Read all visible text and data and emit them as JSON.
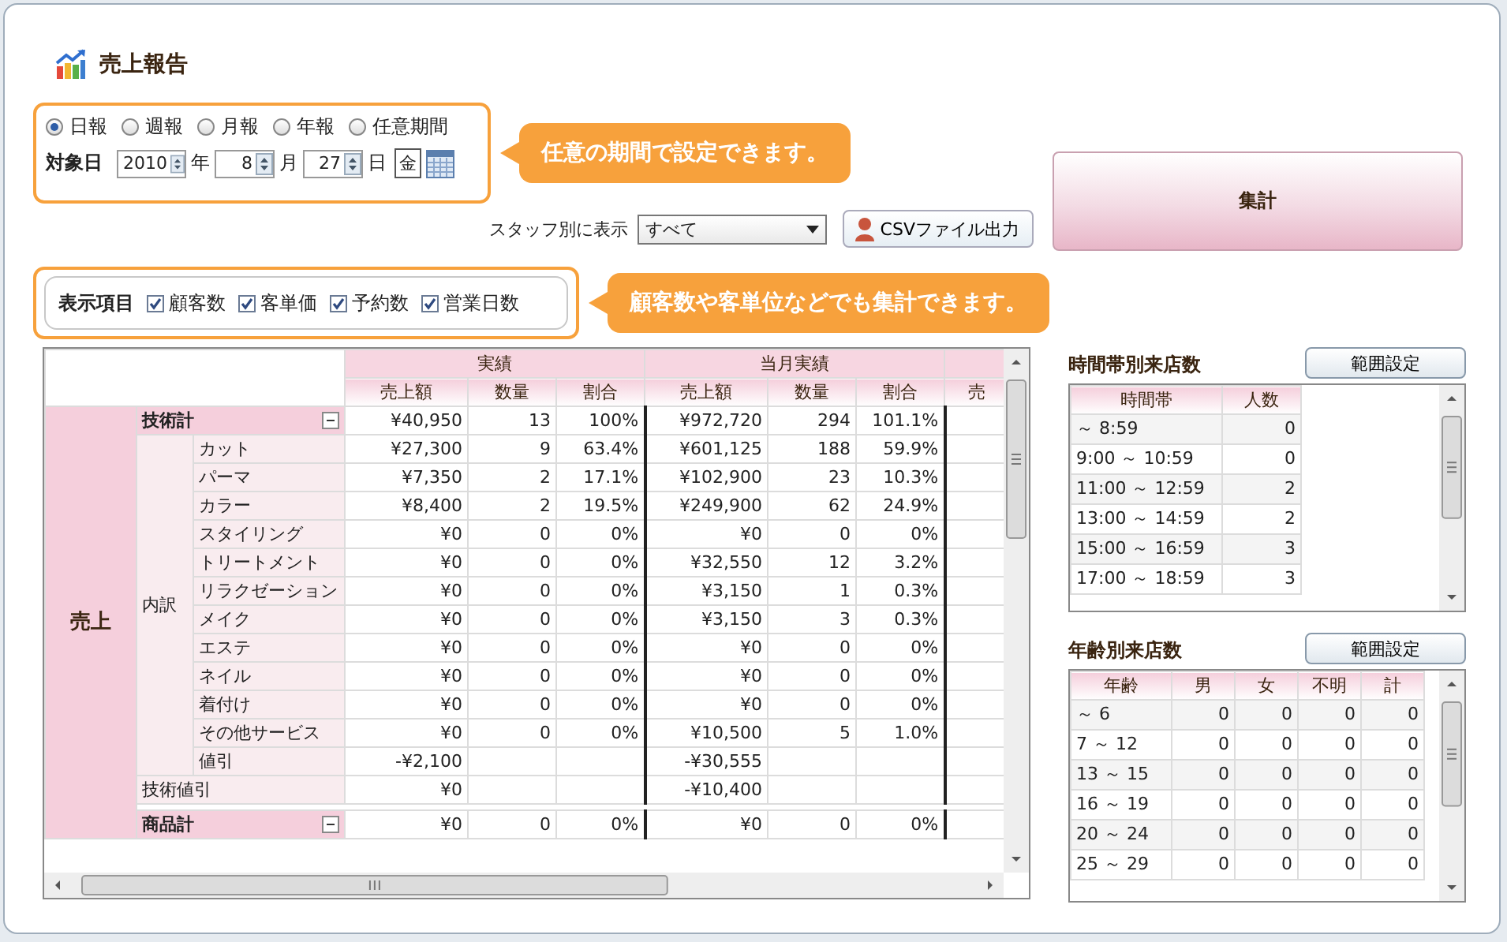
{
  "title": "売上報告",
  "period_options": [
    {
      "label": "日報",
      "selected": true
    },
    {
      "label": "週報",
      "selected": false
    },
    {
      "label": "月報",
      "selected": false
    },
    {
      "label": "年報",
      "selected": false
    },
    {
      "label": "任意期間",
      "selected": false
    }
  ],
  "target_date": {
    "label": "対象日",
    "year": "2010",
    "year_unit": "年",
    "month": "8",
    "month_unit": "月",
    "day": "27",
    "day_unit": "日",
    "weekday": "金"
  },
  "callouts": [
    "任意の期間で設定できます。",
    "顧客数や客単位などでも集計できます。"
  ],
  "staff_filter": {
    "label": "スタッフ別に表示",
    "value": "すべて"
  },
  "csv_button": "CSVファイル出力",
  "aggregate_button": "集計",
  "display_items": {
    "label": "表示項目",
    "options": [
      {
        "label": "顧客数",
        "checked": true
      },
      {
        "label": "客単価",
        "checked": true
      },
      {
        "label": "予約数",
        "checked": true
      },
      {
        "label": "営業日数",
        "checked": true
      }
    ]
  },
  "sales_table": {
    "section": "売上",
    "groups": [
      "実績",
      "当月実績"
    ],
    "columns": [
      "売上額",
      "数量",
      "割合",
      "売上額",
      "数量",
      "割合",
      "売"
    ],
    "blocks": [
      {
        "kind": "total",
        "label": "技術計",
        "expanded": true,
        "cells": [
          "¥40,950",
          "13",
          "100%",
          "¥972,720",
          "294",
          "101.1%"
        ]
      },
      {
        "kind": "group",
        "label": "内訳",
        "children": [
          {
            "label": "カット",
            "cells": [
              "¥27,300",
              "9",
              "63.4%",
              "¥601,125",
              "188",
              "59.9%"
            ]
          },
          {
            "label": "パーマ",
            "cells": [
              "¥7,350",
              "2",
              "17.1%",
              "¥102,900",
              "23",
              "10.3%"
            ]
          },
          {
            "label": "カラー",
            "cells": [
              "¥8,400",
              "2",
              "19.5%",
              "¥249,900",
              "62",
              "24.9%"
            ]
          },
          {
            "label": "スタイリング",
            "cells": [
              "¥0",
              "0",
              "0%",
              "¥0",
              "0",
              "0%"
            ]
          },
          {
            "label": "トリートメント",
            "cells": [
              "¥0",
              "0",
              "0%",
              "¥32,550",
              "12",
              "3.2%"
            ]
          },
          {
            "label": "リラクゼーション",
            "cells": [
              "¥0",
              "0",
              "0%",
              "¥3,150",
              "1",
              "0.3%"
            ]
          },
          {
            "label": "メイク",
            "cells": [
              "¥0",
              "0",
              "0%",
              "¥3,150",
              "3",
              "0.3%"
            ]
          },
          {
            "label": "エステ",
            "cells": [
              "¥0",
              "0",
              "0%",
              "¥0",
              "0",
              "0%"
            ]
          },
          {
            "label": "ネイル",
            "cells": [
              "¥0",
              "0",
              "0%",
              "¥0",
              "0",
              "0%"
            ]
          },
          {
            "label": "着付け",
            "cells": [
              "¥0",
              "0",
              "0%",
              "¥0",
              "0",
              "0%"
            ]
          },
          {
            "label": "その他サービス",
            "cells": [
              "¥0",
              "0",
              "0%",
              "¥10,500",
              "5",
              "1.0%"
            ]
          },
          {
            "label": "値引",
            "cells": [
              "-¥2,100",
              null,
              null,
              "-¥30,555",
              null,
              null
            ]
          }
        ]
      },
      {
        "kind": "plain",
        "label": "技術値引",
        "cells": [
          "¥0",
          null,
          null,
          "-¥10,400",
          null,
          null
        ]
      },
      {
        "kind": "total",
        "label": "商品計",
        "expanded": true,
        "cells": [
          "¥0",
          "0",
          "0%",
          "¥0",
          "0",
          "0%"
        ]
      }
    ]
  },
  "time_table": {
    "title": "時間帯別来店数",
    "button": "範囲設定",
    "columns": [
      "時間帯",
      "人数"
    ],
    "rows": [
      [
        "～ 8:59",
        "0"
      ],
      [
        "9:00 ～ 10:59",
        "0"
      ],
      [
        "11:00 ～ 12:59",
        "2"
      ],
      [
        "13:00 ～ 14:59",
        "2"
      ],
      [
        "15:00 ～ 16:59",
        "3"
      ],
      [
        "17:00 ～ 18:59",
        "3"
      ]
    ]
  },
  "age_table": {
    "title": "年齢別来店数",
    "button": "範囲設定",
    "columns": [
      "年齢",
      "男",
      "女",
      "不明",
      "計"
    ],
    "rows": [
      [
        "～ 6",
        "0",
        "0",
        "0",
        "0"
      ],
      [
        "7 ～ 12",
        "0",
        "0",
        "0",
        "0"
      ],
      [
        "13 ～ 15",
        "0",
        "0",
        "0",
        "0"
      ],
      [
        "16 ～ 19",
        "0",
        "0",
        "0",
        "0"
      ],
      [
        "20 ～ 24",
        "0",
        "0",
        "0",
        "0"
      ],
      [
        "25 ～ 29",
        "0",
        "0",
        "0",
        "0"
      ]
    ]
  }
}
